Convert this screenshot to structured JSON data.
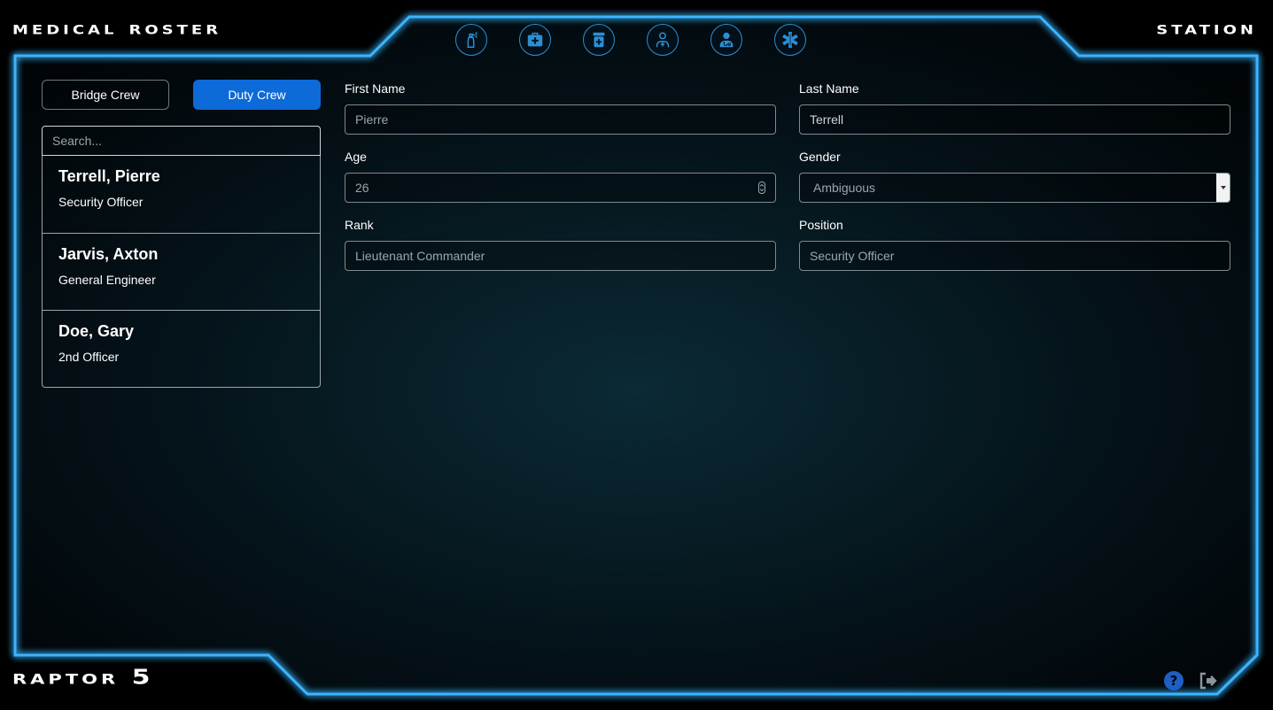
{
  "header": {
    "left_title": "MEDICAL ROSTER",
    "right_title": "STATION"
  },
  "footer": {
    "ship_name": "RAPTOR 5",
    "help_icon": "help-icon",
    "logout_icon": "logout-icon"
  },
  "nav_icons": [
    "spray-bottle-icon",
    "first-aid-kit-icon",
    "pill-bottle-icon",
    "patient-icon",
    "doctor-icon",
    "star-of-life-icon"
  ],
  "crew_toggle": {
    "bridge_label": "Bridge Crew",
    "duty_label": "Duty Crew",
    "active": "Duty Crew"
  },
  "search": {
    "placeholder": "Search..."
  },
  "crew": [
    {
      "name": "Terrell, Pierre",
      "position": "Security Officer"
    },
    {
      "name": "Jarvis, Axton",
      "position": "General Engineer"
    },
    {
      "name": "Doe, Gary",
      "position": "2nd Officer"
    }
  ],
  "form": {
    "first_name": {
      "label": "First Name",
      "value": "Pierre"
    },
    "last_name": {
      "label": "Last Name",
      "value": "Terrell"
    },
    "age": {
      "label": "Age",
      "value": "26"
    },
    "gender": {
      "label": "Gender",
      "value": "Ambiguous"
    },
    "rank": {
      "label": "Rank",
      "value": "Lieutenant Commander"
    },
    "position": {
      "label": "Position",
      "value": "Security Officer"
    }
  },
  "colors": {
    "accent_glow": "#1aa3ff",
    "primary_button": "#0d6ad9",
    "icon_ring": "#2b8fd6"
  }
}
